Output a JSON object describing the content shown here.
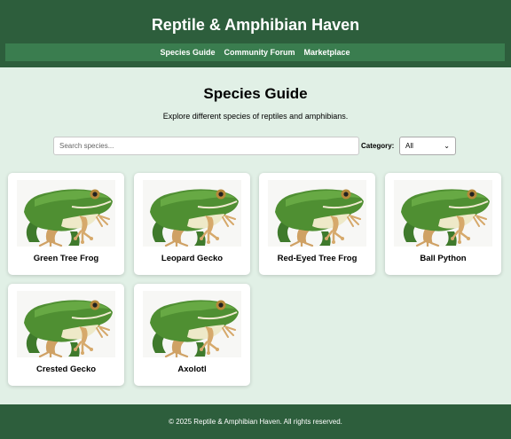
{
  "site": {
    "title": "Reptile & Amphibian Haven"
  },
  "nav": {
    "items": [
      {
        "label": "Species Guide"
      },
      {
        "label": "Community Forum"
      },
      {
        "label": "Marketplace"
      }
    ]
  },
  "main": {
    "title": "Species Guide",
    "subtitle": "Explore different species of reptiles and amphibians.",
    "search": {
      "placeholder": "Search species...",
      "value": ""
    },
    "category": {
      "label": "Category:",
      "selected": "All"
    }
  },
  "species": [
    {
      "name": "Green Tree Frog"
    },
    {
      "name": "Leopard Gecko"
    },
    {
      "name": "Red-Eyed Tree Frog"
    },
    {
      "name": "Ball Python"
    },
    {
      "name": "Crested Gecko"
    },
    {
      "name": "Axolotl"
    }
  ],
  "colors": {
    "header": "#2d5e3c",
    "nav": "#3a7d4f",
    "background": "#e1f0e6"
  },
  "footer": {
    "text": "© 2025 Reptile & Amphibian Haven. All rights reserved."
  }
}
